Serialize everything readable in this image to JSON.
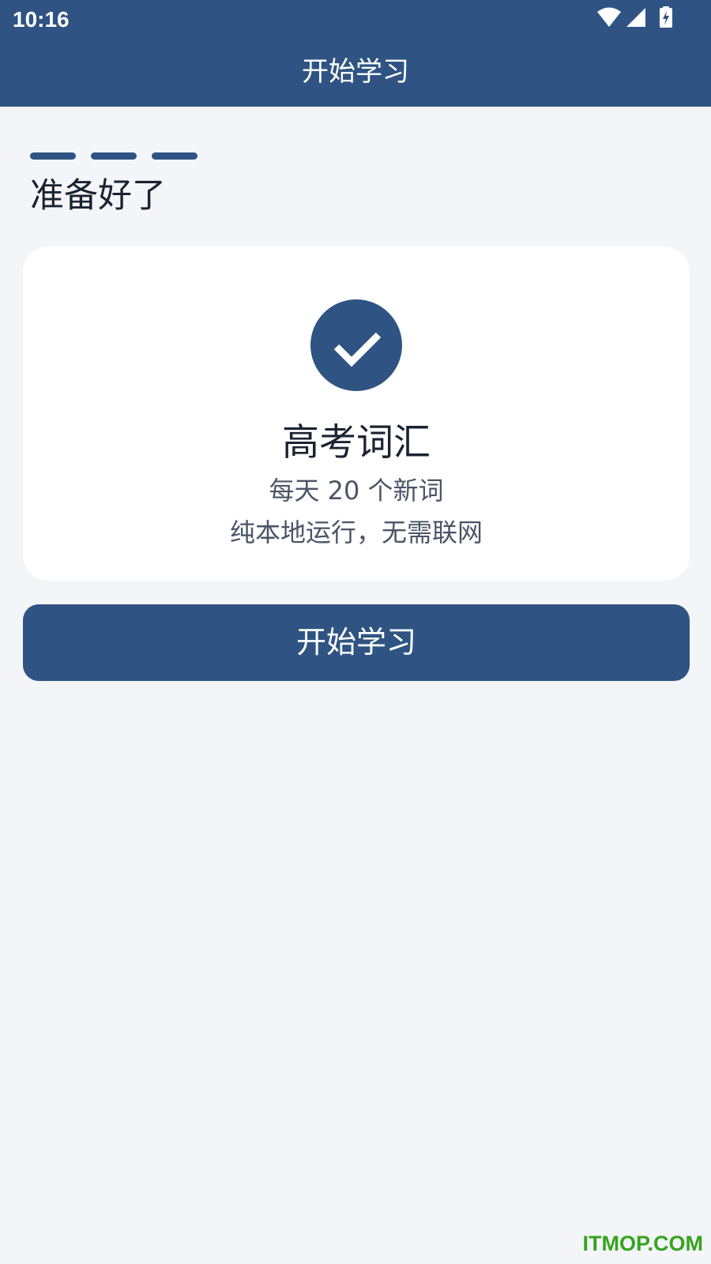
{
  "status_bar": {
    "time": "10:16",
    "icons": [
      "wifi-icon",
      "cell-signal-icon",
      "battery-charging-icon"
    ],
    "icon_color": "#ffffff"
  },
  "app_bar": {
    "title": "开始学习",
    "background": "#2f5483"
  },
  "progress": {
    "current_step": 3,
    "total_steps": 3,
    "color": "#2f5483"
  },
  "page": {
    "title": "准备好了",
    "background": "#f3f5f8"
  },
  "summary_card": {
    "icon": "checkmark-icon",
    "title": "高考词汇",
    "subtitle": "每天 20 个新词",
    "note": "纯本地运行，无需联网"
  },
  "actions": {
    "start_label": "开始学习",
    "accent": "#2f5483"
  },
  "watermark": {
    "text": "ITMOP.COM",
    "color": "#36a31f"
  }
}
